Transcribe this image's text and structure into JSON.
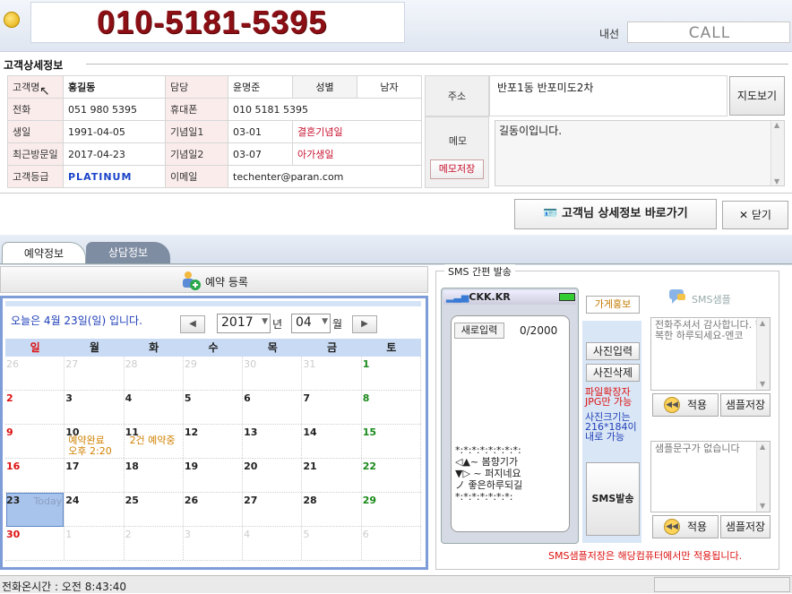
{
  "header": {
    "phone_number": "010-5181-5395",
    "ext_label": "내선",
    "call_label": "CALL"
  },
  "customer": {
    "section_title": "고객상세정보",
    "labels": {
      "name": "고객명",
      "manager": "담당",
      "gender": "성별",
      "phone": "전화",
      "mobile": "휴대폰",
      "birthday": "생일",
      "anniv1": "기념일1",
      "last_visit": "최근방문일",
      "anniv2": "기념일2",
      "grade": "고객등급",
      "email": "이메일",
      "address": "주소",
      "memo": "메모"
    },
    "name": "홍길동",
    "manager": "윤명준",
    "gender": "남자",
    "phone": "051 980 5395",
    "mobile": "010 5181 5395",
    "birthday": "1991-04-05",
    "anniv1_date": "03-01",
    "anniv1_name": "결혼기념일",
    "last_visit": "2017-04-23",
    "anniv2_date": "03-07",
    "anniv2_name": "아가생일",
    "grade": "PLATINUM",
    "email": "techenter@paran.com",
    "address": "반포1동 반포미도2차",
    "map_button": "지도보기",
    "memo_save": "메모저장",
    "memo": "길동이입니다.",
    "detail_button": "고객님 상세정보 바로가기",
    "close_button": "닫기"
  },
  "tabs": [
    {
      "label": "예약정보",
      "active": true
    },
    {
      "label": "상담정보",
      "active": false
    }
  ],
  "reservation": {
    "register_label": "예약 등록",
    "today_text": "오늘은 4월 23일(일) 입니다.",
    "year": "2017",
    "year_suffix": "년",
    "month": "04",
    "month_suffix": "월",
    "prev_icon": "◀",
    "next_icon": "▶",
    "weekdays": [
      "일",
      "월",
      "화",
      "수",
      "목",
      "금",
      "토"
    ],
    "today_label": "Today",
    "weeks": [
      [
        "26",
        "27",
        "28",
        "29",
        "30",
        "31",
        "1"
      ],
      [
        "2",
        "3",
        "4",
        "5",
        "6",
        "7",
        "8"
      ],
      [
        "9",
        "10",
        "11",
        "12",
        "13",
        "14",
        "15"
      ],
      [
        "16",
        "17",
        "18",
        "19",
        "20",
        "21",
        "22"
      ],
      [
        "23",
        "24",
        "25",
        "26",
        "27",
        "28",
        "29"
      ],
      [
        "30",
        "1",
        "2",
        "3",
        "4",
        "5",
        "6"
      ]
    ],
    "events": {
      "day10_line1": "예약완료",
      "day10_line2": "오후 2:20",
      "day11": "2건 예약중"
    }
  },
  "sms": {
    "group_title": "SMS 간편 발송",
    "carrier": "CKK.KR",
    "new_input": "새로입력",
    "counter": "0/2000",
    "message": "*:*:*:*:*:*:*:*:\n◁▲~ 봄향기가\n▼▷ ~ 퍼지네요\nノ 좋은하루되길\n*:*:*:*:*:*:*:",
    "store_promo": "가게홍보",
    "photo_input": "사진입력",
    "photo_delete": "사진삭제",
    "file_note": "파일확장자 JPG만 가능",
    "size_note": "사진크기는 216*184이내로 가능",
    "send_button": "SMS발송",
    "sample_title": "SMS샘플",
    "sample1": "전화주셔서 감사합니다. 행복한 하루되세요-엔코",
    "sample2": "샘플문구가 없습니다",
    "apply_button": "적용",
    "save_sample_button": "샘플저장",
    "footer_note": "SMS샘플저장은 해당컴퓨터에서만 적용됩니다."
  },
  "status": {
    "text": "전화온시간 : 오전 8:43:40"
  }
}
